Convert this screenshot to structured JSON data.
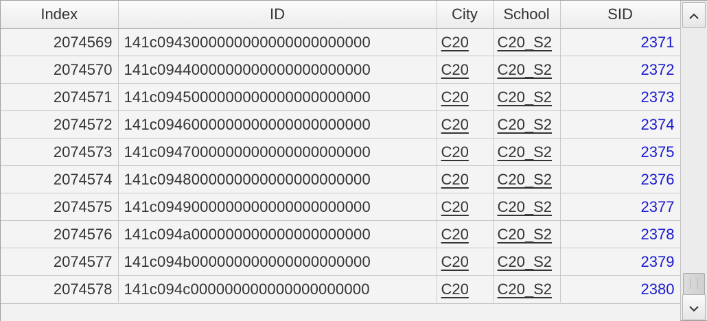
{
  "columns": [
    "Index",
    "ID",
    "City",
    "School",
    "SID"
  ],
  "rows": [
    {
      "index": "2074569",
      "id": "141c0943000000000000000000000",
      "city": "C20",
      "school": "C20_S2",
      "sid": "2371"
    },
    {
      "index": "2074570",
      "id": "141c0944000000000000000000000",
      "city": "C20",
      "school": "C20_S2",
      "sid": "2372"
    },
    {
      "index": "2074571",
      "id": "141c0945000000000000000000000",
      "city": "C20",
      "school": "C20_S2",
      "sid": "2373"
    },
    {
      "index": "2074572",
      "id": "141c0946000000000000000000000",
      "city": "C20",
      "school": "C20_S2",
      "sid": "2374"
    },
    {
      "index": "2074573",
      "id": "141c0947000000000000000000000",
      "city": "C20",
      "school": "C20_S2",
      "sid": "2375"
    },
    {
      "index": "2074574",
      "id": "141c0948000000000000000000000",
      "city": "C20",
      "school": "C20_S2",
      "sid": "2376"
    },
    {
      "index": "2074575",
      "id": "141c0949000000000000000000000",
      "city": "C20",
      "school": "C20_S2",
      "sid": "2377"
    },
    {
      "index": "2074576",
      "id": "141c094a000000000000000000000",
      "city": "C20",
      "school": "C20_S2",
      "sid": "2378"
    },
    {
      "index": "2074577",
      "id": "141c094b000000000000000000000",
      "city": "C20",
      "school": "C20_S2",
      "sid": "2379"
    },
    {
      "index": "2074578",
      "id": "141c094c000000000000000000000",
      "city": "C20",
      "school": "C20_S2",
      "sid": "2380"
    }
  ],
  "scrollbar": {
    "up_icon": "chevron-up-icon",
    "down_icon": "chevron-down-icon",
    "scroll_position": 0.97
  },
  "colors": {
    "sid_text": "#1a1ad0",
    "cell_background": "#f4f4f4",
    "gridline": "#c8c8c8"
  }
}
